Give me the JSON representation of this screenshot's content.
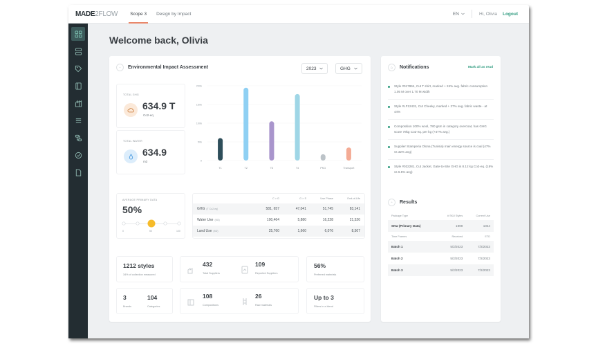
{
  "header": {
    "logo_bold": "MADE",
    "logo_light": "2FLOW",
    "tabs": [
      {
        "label": "Scope 3",
        "active": true
      },
      {
        "label": "Design by Impact",
        "active": false
      }
    ],
    "language": "EN",
    "greeting": "Hi, Olivia",
    "logout_label": "Logout"
  },
  "sidebar": {
    "items": [
      {
        "icon": "dashboard-grid-icon",
        "active": true
      },
      {
        "icon": "database-icon",
        "active": false
      },
      {
        "icon": "tag-icon",
        "active": false
      },
      {
        "icon": "book-icon",
        "active": false
      },
      {
        "icon": "factory-icon",
        "active": false
      },
      {
        "icon": "list-icon",
        "active": false
      },
      {
        "icon": "flow-icon",
        "active": false
      },
      {
        "icon": "check-circle-icon",
        "active": false
      },
      {
        "icon": "document-icon",
        "active": false
      }
    ]
  },
  "page": {
    "title": "Welcome back, Olivia"
  },
  "impact": {
    "title": "Environmental Impact Assessment",
    "year_select": "2023",
    "metric_select": "GHG",
    "total_ghg": {
      "label": "TOTAL GHG",
      "value": "634.9 T",
      "unit": "Co2-eq"
    },
    "total_water": {
      "label": "TOTAL WATER",
      "value": "634.9",
      "unit": "m3"
    },
    "primary_data": {
      "label": "AVERAGE PRIMARY DATA",
      "value": "50%",
      "level": 0.5,
      "ticks": [
        "0",
        "50",
        "100"
      ]
    },
    "table": {
      "columns": [
        "C > G",
        "G > S",
        "Use Phase",
        "End-of-Life"
      ],
      "rows": [
        {
          "label": "GHG",
          "unit": "(T Co2-eq)",
          "values": [
            "581, 657",
            "47,041",
            "51,745",
            "83,141"
          ]
        },
        {
          "label": "Water Use",
          "unit": "(M3)",
          "values": [
            "100,464",
            "5,880",
            "16,228",
            "21,520"
          ]
        },
        {
          "label": "Land Use",
          "unit": "(M2)",
          "values": [
            "25,760",
            "1,660",
            "6,076",
            "8,507"
          ]
        }
      ]
    }
  },
  "chart_data": {
    "type": "bar",
    "categories": [
      "T1",
      "T2",
      "T3",
      "T4",
      "PKG",
      "Transport"
    ],
    "values": [
      60000,
      195000,
      105000,
      178000,
      17000,
      35000
    ],
    "colors": [
      "#2e4e5a",
      "#8fd0f3",
      "#a995cc",
      "#9fd6e6",
      "#bcc3c8",
      "#f4ab95"
    ],
    "yticks": [
      "0",
      "50k",
      "100k",
      "150k",
      "200k"
    ],
    "ylim": [
      0,
      200000
    ],
    "title": "",
    "xlabel": "",
    "ylabel": "",
    "grid": true
  },
  "kpis": {
    "styles": {
      "value": "1212 styles",
      "label": "34% of collection measured"
    },
    "total_suppliers": {
      "value": "432",
      "label": "Total Suppliers"
    },
    "reported_suppliers": {
      "value": "109",
      "label": "Reported Suppliers"
    },
    "preferred": {
      "value": "56%",
      "label": "Preferred materials"
    },
    "brands": {
      "value": "3",
      "label": "Brands"
    },
    "categories": {
      "value": "104",
      "label": "Categories"
    },
    "compositions": {
      "value": "108",
      "label": "Compositions"
    },
    "raw_materials": {
      "value": "26",
      "label": "Raw materials"
    },
    "filters": {
      "value": "Up to 3",
      "label": "Filters in a blend"
    }
  },
  "notifications": {
    "title": "Notifications",
    "mark_all_label": "Mark all as read",
    "items": [
      "Style #017864, Cut T shirt, marked + 24% avg. fabric consumption 1.05 M over 1.70 M width",
      "Style #LF12431, Cut Cheeky, marked + 27% avg. fabric waste - at 44%",
      "Composition 100% wool, 780 gsm in category overcoat, has GHG score 78kg Co2-eq. per kg (+47% avg.)",
      "Supplier Stamperia Olona (Tunisia) main energy source is coal (47% vs 32% avg)",
      "Style #032281, Cut Jacket, Gate-to-Site GHG is 8.12 kg Co2-eq. (18% vs 6.5% avg)"
    ]
  },
  "results": {
    "title": "Results",
    "head1": [
      "Package Type",
      "# SKU Styles",
      "Current Use"
    ],
    "sku_row": [
      "SKU (Primary Data)",
      "1999",
      "1044"
    ],
    "head2": [
      "Time Frames",
      "Received",
      "ETD"
    ],
    "batches": [
      [
        "Batch 1",
        "5/2/2023",
        "7/2/2023"
      ],
      [
        "Batch 2",
        "5/2/2023",
        "7/2/2023"
      ],
      [
        "Batch 3",
        "5/2/2023",
        "7/2/2023"
      ]
    ]
  }
}
